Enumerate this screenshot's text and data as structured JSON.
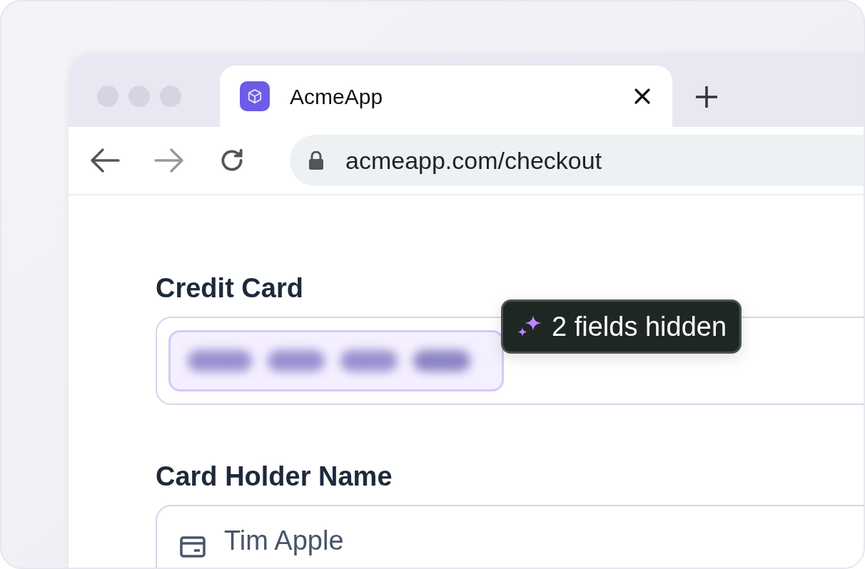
{
  "tab": {
    "title": "AcmeApp"
  },
  "address_bar": {
    "url": "acmeapp.com/checkout"
  },
  "fields": [
    {
      "kind": "redacted",
      "label": "Credit Card"
    },
    {
      "kind": "text",
      "label": "Card Holder Name",
      "value": "Tim Apple"
    }
  ],
  "hidden_badge": {
    "text": "2 fields hidden"
  }
}
